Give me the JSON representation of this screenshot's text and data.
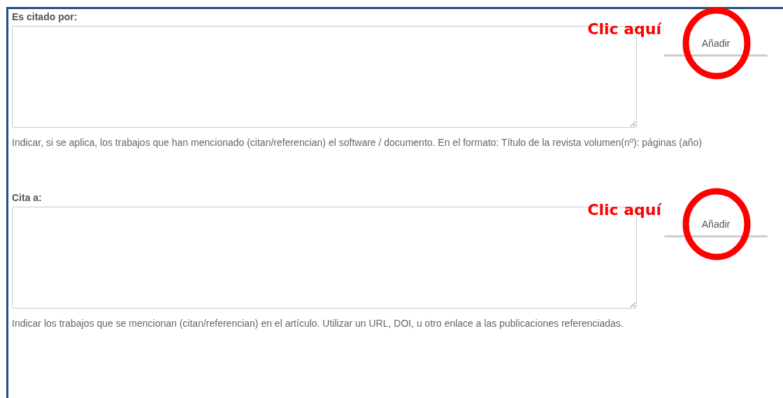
{
  "sections": [
    {
      "label": "Es citado por:",
      "button": "Añadir",
      "annotation": "Clic aquí",
      "help": "Indicar, si se aplica, los trabajos que han mencionado (citan/referencian) el software / documento.  En el formato: Título de la revista volumen(nº): páginas (año)"
    },
    {
      "label": "Cita a:",
      "button": "Añadir",
      "annotation": "Clic aquí",
      "help": "Indicar los trabajos que se mencionan (citan/referencian) en el artículo. Utilizar un URL, DOI, u otro enlace a las publicaciones referenciadas."
    }
  ]
}
